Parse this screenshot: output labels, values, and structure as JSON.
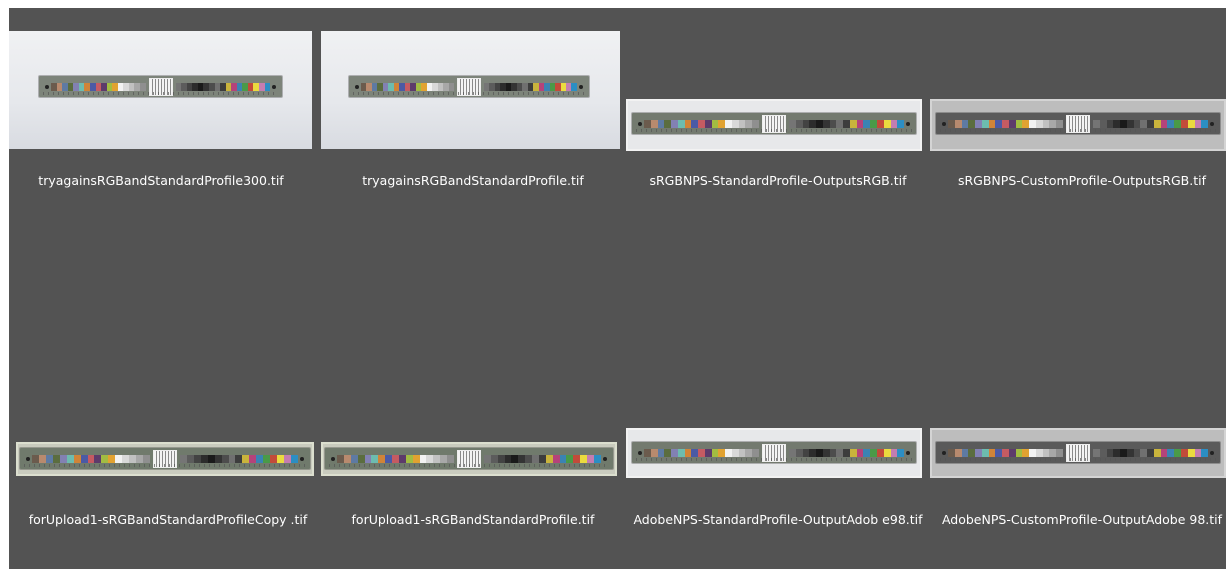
{
  "thumbnails": [
    {
      "filename": "tryagainsRGBandStandardProfile300.tif"
    },
    {
      "filename": "tryagainsRGBandStandardProfile.tif"
    },
    {
      "filename": "sRGBNPS-StandardProfile-OutputsRGB.tif"
    },
    {
      "filename": "sRGBNPS-CustomProfile-OutputsRGB.tif"
    },
    {
      "filename": "forUpload1-sRGBandStandardProfileCopy .tif"
    },
    {
      "filename": "forUpload1-sRGBandStandardProfile.tif"
    },
    {
      "filename": "AdobeNPS-StandardProfile-OutputAdob e98.tif"
    },
    {
      "filename": "AdobeNPS-CustomProfile-OutputAdobe 98.tif"
    }
  ],
  "colors": {
    "viewer_background": "#535353",
    "label_text": "#ffffff"
  }
}
